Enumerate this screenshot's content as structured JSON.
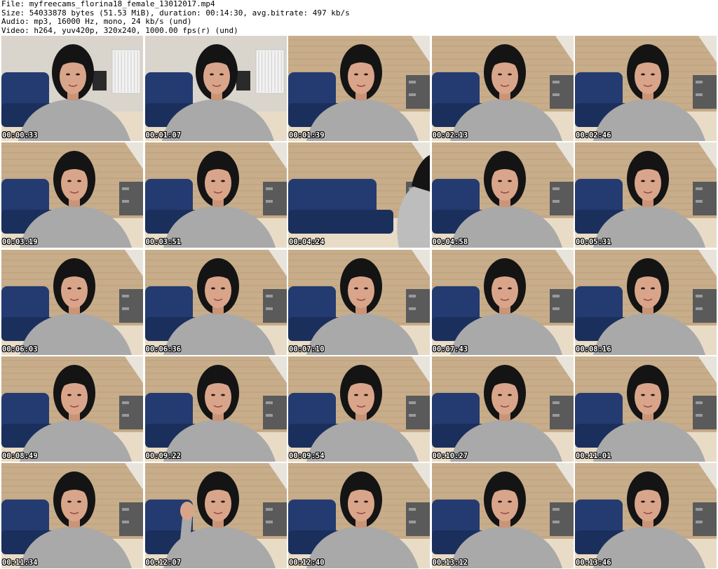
{
  "header": {
    "file_line": "File: myfreecams_florina18_female_13012017.mp4",
    "size_line": "Size: 54033878 bytes (51.53 MiB), duration: 00:14:30, avg.bitrate: 497 kb/s",
    "audio_line": "Audio: mp3, 16000 Hz, mono, 24 kb/s (und)",
    "video_line": "Video: h264, yuv420p, 320x240, 1000.00 fps(r) (und)"
  },
  "thumbnails": [
    {
      "timestamp": "00:00:33",
      "scene": "room"
    },
    {
      "timestamp": "00:01:07",
      "scene": "room"
    },
    {
      "timestamp": "00:01:39",
      "scene": "brick"
    },
    {
      "timestamp": "00:02:13",
      "scene": "brick"
    },
    {
      "timestamp": "00:02:46",
      "scene": "brick"
    },
    {
      "timestamp": "00:03:19",
      "scene": "brick"
    },
    {
      "timestamp": "00:03:51",
      "scene": "brick"
    },
    {
      "timestamp": "00:04:24",
      "scene": "empty"
    },
    {
      "timestamp": "00:04:58",
      "scene": "brick"
    },
    {
      "timestamp": "00:05:31",
      "scene": "brick"
    },
    {
      "timestamp": "00:06:03",
      "scene": "brick"
    },
    {
      "timestamp": "00:06:36",
      "scene": "brick"
    },
    {
      "timestamp": "00:07:10",
      "scene": "brick"
    },
    {
      "timestamp": "00:07:43",
      "scene": "brick"
    },
    {
      "timestamp": "00:08:16",
      "scene": "brick"
    },
    {
      "timestamp": "00:08:49",
      "scene": "brick"
    },
    {
      "timestamp": "00:09:22",
      "scene": "brick"
    },
    {
      "timestamp": "00:09:54",
      "scene": "brick"
    },
    {
      "timestamp": "00:10:27",
      "scene": "brick"
    },
    {
      "timestamp": "00:11:01",
      "scene": "brick"
    },
    {
      "timestamp": "00:11:34",
      "scene": "brick"
    },
    {
      "timestamp": "00:12:07",
      "scene": "wave"
    },
    {
      "timestamp": "00:12:40",
      "scene": "brick"
    },
    {
      "timestamp": "00:13:12",
      "scene": "brick"
    },
    {
      "timestamp": "00:13:46",
      "scene": "brick"
    }
  ],
  "colors": {
    "background": "#ffffff",
    "header_text": "#000000",
    "timestamp_text": "#ffffff",
    "timestamp_outline": "#000000",
    "wall": "#c7ad8a",
    "couch": "#233b70",
    "sweater": "#a9a9a9",
    "hair": "#141414",
    "skin": "#d9a58a"
  }
}
